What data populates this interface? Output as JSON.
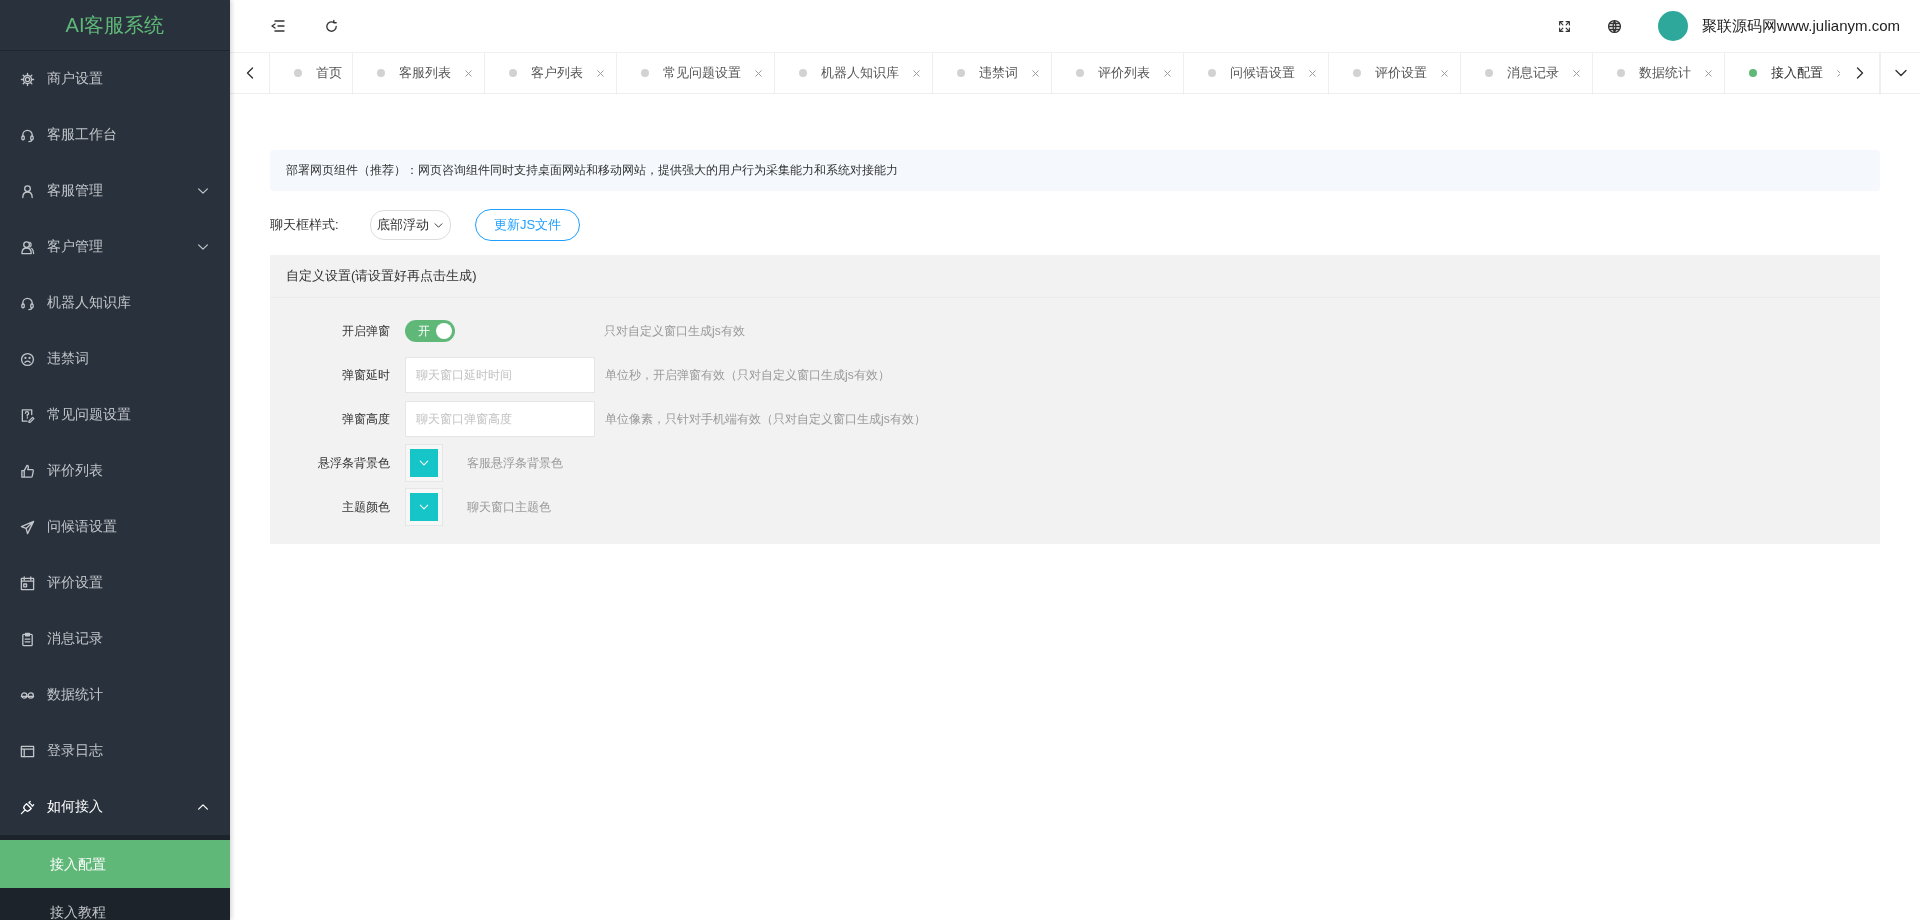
{
  "sidebar": {
    "logo": "AI客服系统",
    "items": [
      {
        "label": "商户设置",
        "selected": false
      },
      {
        "label": "客服工作台",
        "selected": false
      },
      {
        "label": "客服管理",
        "expanded": false,
        "selected": false
      },
      {
        "label": "客户管理",
        "expanded": false,
        "selected": false
      },
      {
        "label": "机器人知识库",
        "selected": false
      },
      {
        "label": "违禁词",
        "selected": false
      },
      {
        "label": "常见问题设置",
        "selected": false
      },
      {
        "label": "评价列表",
        "selected": false
      },
      {
        "label": "问候语设置",
        "selected": false
      },
      {
        "label": "评价设置",
        "selected": false
      },
      {
        "label": "消息记录",
        "selected": false
      },
      {
        "label": "数据统计",
        "selected": false
      },
      {
        "label": "登录日志",
        "selected": false
      },
      {
        "label": "如何接入",
        "expanded": true,
        "selected": false,
        "children": [
          {
            "label": "接入配置",
            "selected": true
          },
          {
            "label": "接入教程",
            "selected": false
          }
        ]
      }
    ]
  },
  "header": {
    "user_name": "聚联源码网www.julianym.com"
  },
  "tabs": [
    {
      "label": "首页",
      "selected": false,
      "closable": false
    },
    {
      "label": "客服列表",
      "selected": false,
      "closable": true
    },
    {
      "label": "客户列表",
      "selected": false,
      "closable": true
    },
    {
      "label": "常见问题设置",
      "selected": false,
      "closable": true
    },
    {
      "label": "机器人知识库",
      "selected": false,
      "closable": true
    },
    {
      "label": "违禁词",
      "selected": false,
      "closable": true
    },
    {
      "label": "评价列表",
      "selected": false,
      "closable": true
    },
    {
      "label": "问候语设置",
      "selected": false,
      "closable": true
    },
    {
      "label": "评价设置",
      "selected": false,
      "closable": true
    },
    {
      "label": "消息记录",
      "selected": false,
      "closable": true
    },
    {
      "label": "数据统计",
      "selected": false,
      "closable": true
    },
    {
      "label": "接入配置",
      "selected": true,
      "closable": true
    }
  ],
  "content": {
    "notice": "部署网页组件（推荐）：网页咨询组件同时支持桌面网站和移动网站，提供强大的用户行为采集能力和系统对接能力",
    "style_label": "聊天框样式:",
    "style_value": "底部浮动",
    "update_button": "更新JS文件",
    "panel": {
      "title": "自定义设置(请设置好再点击生成)",
      "rows": [
        {
          "kind": "switch",
          "label": "开启弹窗",
          "on": true,
          "switch_text": "开",
          "hint": "只对自定义窗口生成js有效"
        },
        {
          "kind": "input",
          "label": "弹窗延时",
          "placeholder": "聊天窗口延时时间",
          "hint": "单位秒，开启弹窗有效（只对自定义窗口生成js有效）"
        },
        {
          "kind": "input",
          "label": "弹窗高度",
          "placeholder": "聊天窗口弹窗高度",
          "hint": "单位像素，只针对手机端有效（只对自定义窗口生成js有效）"
        },
        {
          "kind": "color",
          "label": "悬浮条背景色",
          "color": "#16c5c8",
          "hint": "客服悬浮条背景色"
        },
        {
          "kind": "color",
          "label": "主题颜色",
          "color": "#16c5c8",
          "hint": "聊天窗口主题色"
        }
      ]
    }
  }
}
